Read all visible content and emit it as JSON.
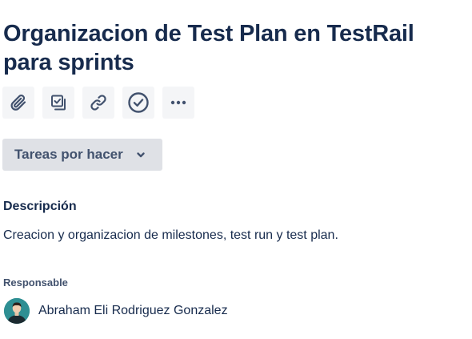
{
  "issue": {
    "title_line1": "Organizacion de Test Plan en TestRail",
    "title_line2": "para sprints"
  },
  "toolbar": {
    "buttons": [
      {
        "icon": "attachment-icon"
      },
      {
        "icon": "subtask-icon"
      },
      {
        "icon": "link-icon"
      },
      {
        "icon": "checkmark-circle-icon"
      },
      {
        "icon": "more-icon"
      }
    ]
  },
  "status": {
    "label": "Tareas por hacer"
  },
  "description": {
    "heading": "Descripción",
    "text": "Creacion y organizacion de milestones, test run y test plan."
  },
  "assignee": {
    "label": "Responsable",
    "name": "Abraham Eli Rodriguez Gonzalez"
  },
  "colors": {
    "text_primary": "#172b4d",
    "text_secondary": "#42526e",
    "button_bg": "#f4f5f7",
    "status_bg": "#dfe1e6"
  }
}
